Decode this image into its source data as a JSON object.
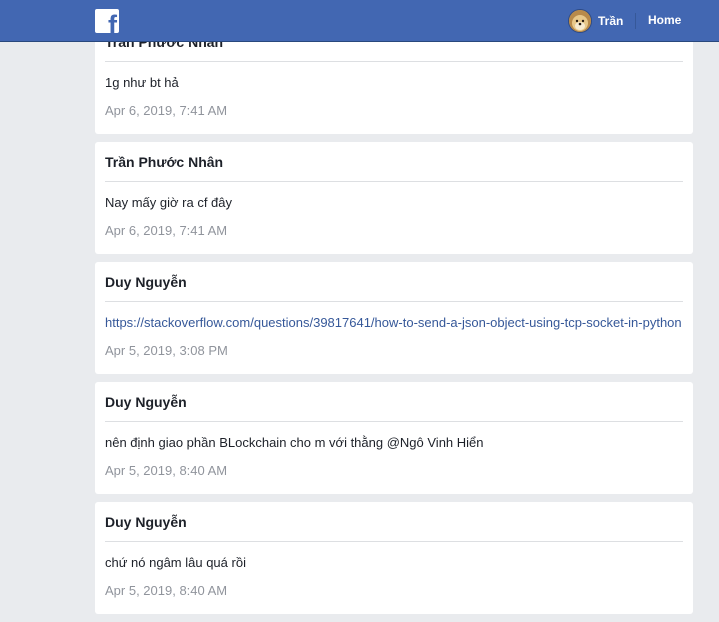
{
  "header": {
    "user_name": "Trần",
    "home_label": "Home"
  },
  "messages": [
    {
      "sender": "Trần Phước Nhân",
      "text": "1g như bt hả",
      "time": "Apr 6, 2019, 7:41 AM"
    },
    {
      "sender": "Trần Phước Nhân",
      "text": "Nay mấy giờ ra cf đây",
      "time": "Apr 6, 2019, 7:41 AM"
    },
    {
      "sender": "Duy Nguyễn",
      "link": "https://stackoverflow.com/questions/39817641/how-to-send-a-json-object-using-tcp-socket-in-python",
      "time": "Apr 5, 2019, 3:08 PM"
    },
    {
      "sender": "Duy Nguyễn",
      "text": "nên định giao phần BLockchain cho m với thằng @Ngô Vinh Hiển",
      "time": "Apr 5, 2019, 8:40 AM"
    },
    {
      "sender": "Duy Nguyễn",
      "text": "chứ nó ngâm lâu quá rồi",
      "time": "Apr 5, 2019, 8:40 AM"
    }
  ]
}
